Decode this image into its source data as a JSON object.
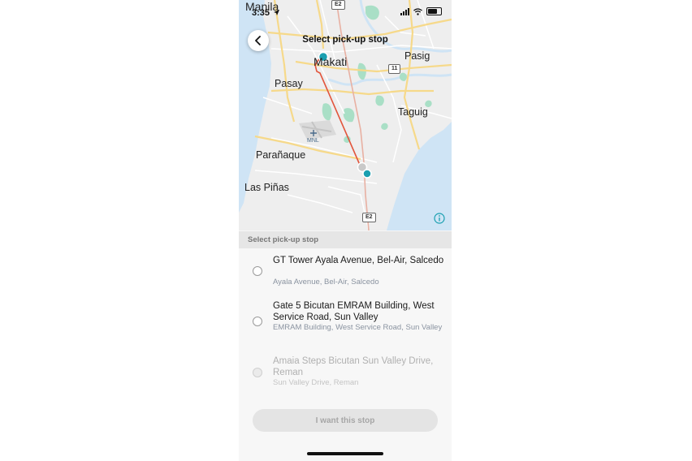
{
  "status_bar": {
    "time": "3:35"
  },
  "header": {
    "title": "Select pick-up stop"
  },
  "map": {
    "labels": {
      "manila": "Manila",
      "makati": "Makati",
      "pasay": "Pasay",
      "pasig": "Pasig",
      "taguig": "Taguig",
      "paranaque": "Parañaque",
      "las_pinas": "Las Piñas",
      "mnl": "MNL"
    },
    "shields": {
      "e2_top": "E2",
      "r11": "11",
      "e2_bottom": "E2"
    },
    "colors": {
      "water": "#cfe4f5",
      "route": "#e2553c",
      "marker": "#1a9fb0",
      "park": "#a9dfc6"
    }
  },
  "section": {
    "title": "Select pick-up stop"
  },
  "stops": [
    {
      "title": "GT Tower Ayala Avenue, Bel-Air, Salcedo",
      "subtitle": "Ayala Avenue, Bel-Air, Salcedo",
      "enabled": true
    },
    {
      "title": "Gate 5 Bicutan EMRAM Building, West Service Road, Sun Valley",
      "subtitle": "EMRAM Building, West Service Road, Sun Valley",
      "enabled": true
    },
    {
      "title": "Amaia Steps Bicutan Sun Valley Drive, Reman",
      "subtitle": "Sun Valley Drive, Reman",
      "enabled": false
    }
  ],
  "confirm_button": {
    "label": "I want this stop"
  }
}
